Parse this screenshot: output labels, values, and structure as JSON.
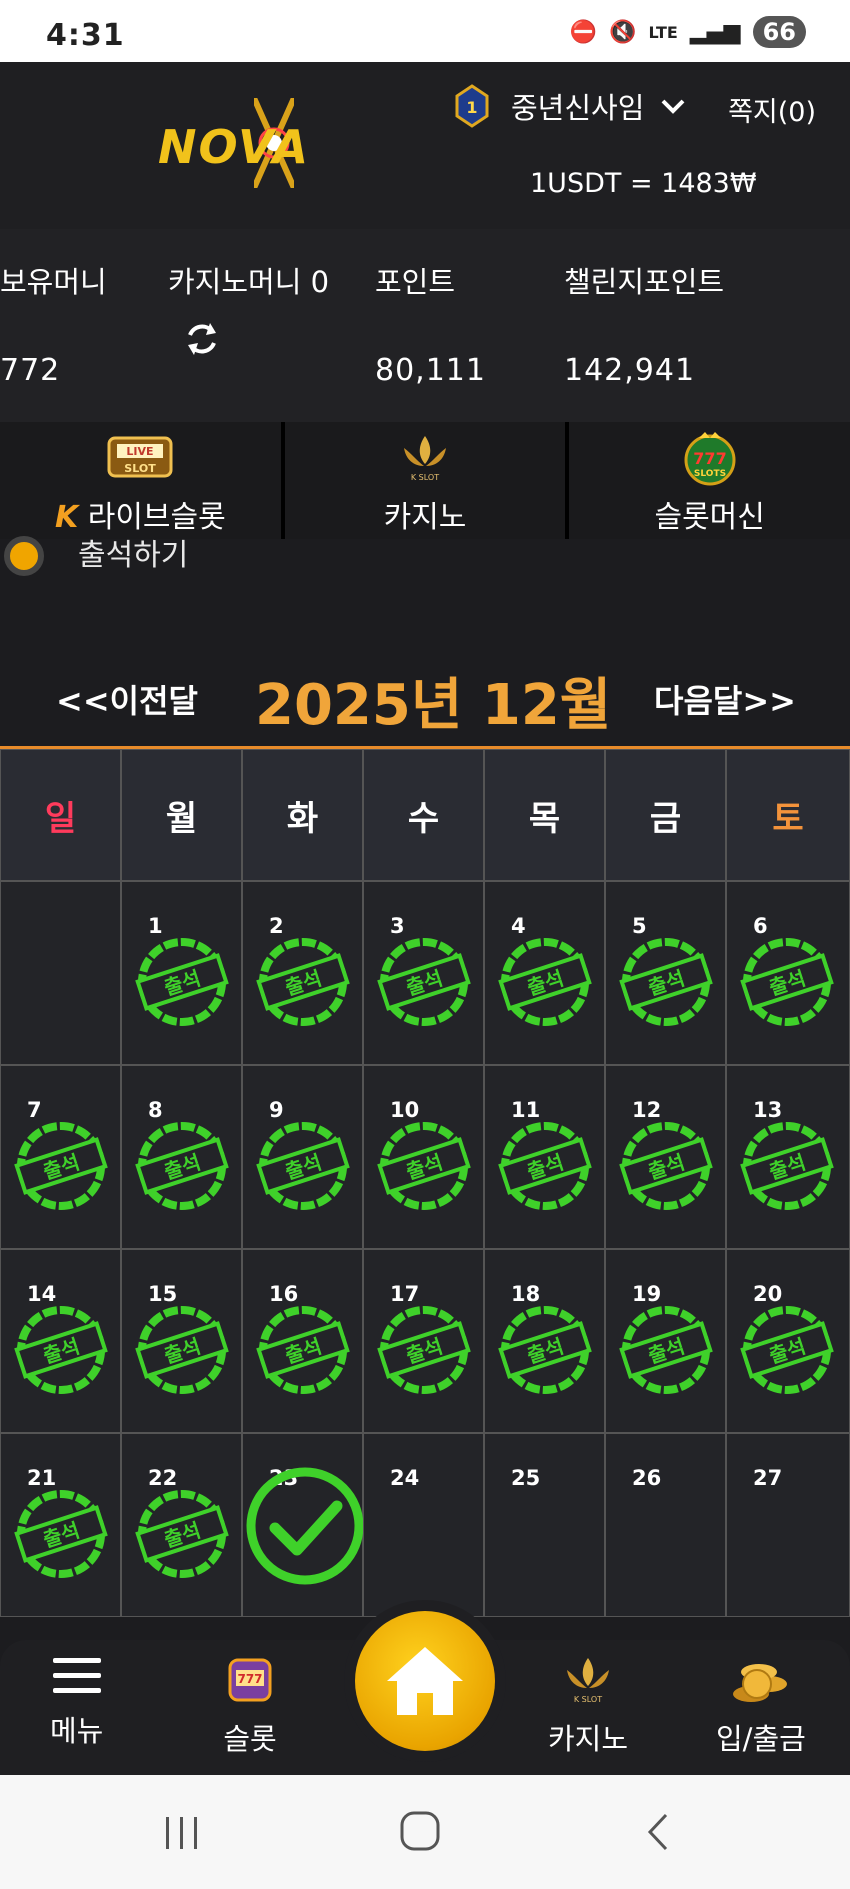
{
  "status_bar": {
    "time": "4:31",
    "network": "LTE",
    "battery": "66"
  },
  "header": {
    "logo_text": "NOVA",
    "rank_level": "1",
    "username": "중년신사임",
    "messages": "쪽지(0)",
    "rate": "1USDT = 1483₩"
  },
  "stats": {
    "holding_label": "보유머니",
    "holding_value": "772",
    "casino_label": "카지노머니 0",
    "point_label": "포인트",
    "point_value": "80,111",
    "challenge_label": "챌린지포인트",
    "challenge_value": "142,941"
  },
  "game_tabs": [
    {
      "label": "라이브슬롯",
      "icon": "live-slot-icon"
    },
    {
      "label": "카지노",
      "icon": "kslot-icon"
    },
    {
      "label": "슬롯머신",
      "icon": "777-slots-icon"
    }
  ],
  "attendance": {
    "title": "출석하기"
  },
  "month_nav": {
    "prev": "<<이전달",
    "title": "2025년 12월",
    "next": "다음달>>"
  },
  "weekdays": [
    "일",
    "월",
    "화",
    "수",
    "목",
    "금",
    "토"
  ],
  "stamp_text": "출석",
  "weeks": [
    [
      "",
      "1",
      "2",
      "3",
      "4",
      "5",
      "6"
    ],
    [
      "7",
      "8",
      "9",
      "10",
      "11",
      "12",
      "13"
    ],
    [
      "14",
      "15",
      "16",
      "17",
      "18",
      "19",
      "20"
    ],
    [
      "21",
      "22",
      "23",
      "24",
      "25",
      "26",
      "27"
    ]
  ],
  "attended_days": 22,
  "today": 23,
  "bottom_nav": {
    "menu": "메뉴",
    "slot": "슬롯",
    "casino": "카지노",
    "deposit": "입/출금"
  },
  "colors": {
    "accent_orange": "#f0a53a",
    "stamp_green": "#3fd12a",
    "sunday": "#ff3b5c",
    "saturday": "#f3933b",
    "home_gold": "#f5b800"
  }
}
